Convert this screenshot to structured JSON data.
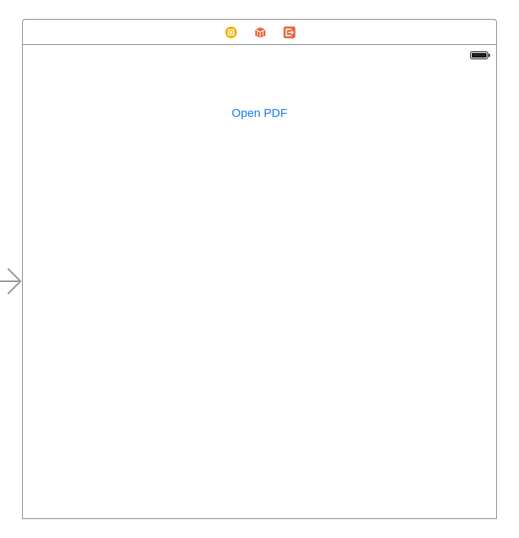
{
  "scene_dock": {
    "icons": [
      {
        "name": "view-controller-icon",
        "color": "#f5c400"
      },
      {
        "name": "first-responder-icon",
        "color": "#e8693c"
      },
      {
        "name": "exit-icon",
        "color": "#e8693c"
      }
    ]
  },
  "status_bar": {
    "battery_icon": "battery-icon"
  },
  "main": {
    "open_pdf_label": "Open PDF",
    "button_color": "#1a7ff2"
  },
  "storyboard": {
    "entry_point_icon": "entry-point-arrow-icon"
  }
}
